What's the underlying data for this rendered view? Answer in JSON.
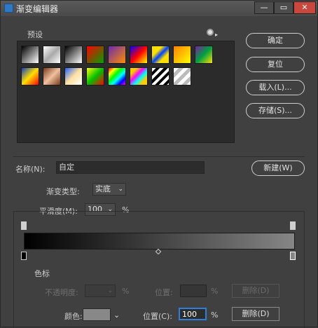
{
  "window": {
    "title": "渐变编辑器",
    "min_glyph": "—",
    "max_glyph": "▭",
    "close_glyph": "✕"
  },
  "presets": {
    "label": "预设",
    "menu_icon": "gear-icon",
    "swatch_colors": [
      "linear-gradient(135deg,#000,#fff)",
      "linear-gradient(135deg,#fff 0,#aaa 50%,#fff 100%)",
      "linear-gradient(135deg,#000,#fff)",
      "linear-gradient(135deg,#ff0000,#00a000)",
      "linear-gradient(135deg,#6a2bb0,#ff8c00)",
      "linear-gradient(135deg,#0000ff,#ff0000,#ffff00)",
      "linear-gradient(135deg,#ffe000 30%,#0040ff 50%,#ffe000 70%)",
      "linear-gradient(135deg,#ff8000,#ffff00)",
      "linear-gradient(135deg,#7a1fa0,#00a040,#ffe000)",
      "linear-gradient(135deg,#1040c0,#ffe000,#ff0000)",
      "linear-gradient(135deg,#7a3b1a,#f0c0a0,#7a3b1a)",
      "linear-gradient(135deg,#2060ff,#ffe0a0,#ffffff)",
      "linear-gradient(135deg,#ffff00,#00c000,#ff0000)",
      "linear-gradient(135deg,#ff0000,#ffff00,#00ff00,#00ffff,#0000ff,#ff00ff)",
      "linear-gradient(135deg,#ffcc00 20%,#ff00ff 40%,#00ffff 60%,#ffcc00 80%)",
      "repeating-linear-gradient(135deg,#fff 0 4px,#000 4px 8px)",
      "repeating-linear-gradient(135deg,#fff 0 5px,#bbb 5px 10px)"
    ]
  },
  "buttons": {
    "ok": "确定",
    "reset": "复位",
    "load": "载入(L)...",
    "save": "存储(S)...",
    "new": "新建(W)",
    "delete_opacity": "删除(D)",
    "delete_color": "删除(D)"
  },
  "name": {
    "label": "名称(N):",
    "value": "自定"
  },
  "gradient_type": {
    "label": "渐变类型:",
    "value": "实底"
  },
  "smoothness": {
    "label": "平滑度(M):",
    "value": "100",
    "unit": "%"
  },
  "stops": {
    "section_label": "色标",
    "opacity_label": "不透明度:",
    "opacity_unit": "%",
    "opacity_location_label": "位置:",
    "opacity_location_unit": "%",
    "color_label": "颜色:",
    "color_value": "#888888",
    "location_label": "位置(C):",
    "location_value": "100",
    "location_unit": "%"
  },
  "gradient": {
    "start_color": "#000000",
    "end_color": "#868686"
  }
}
